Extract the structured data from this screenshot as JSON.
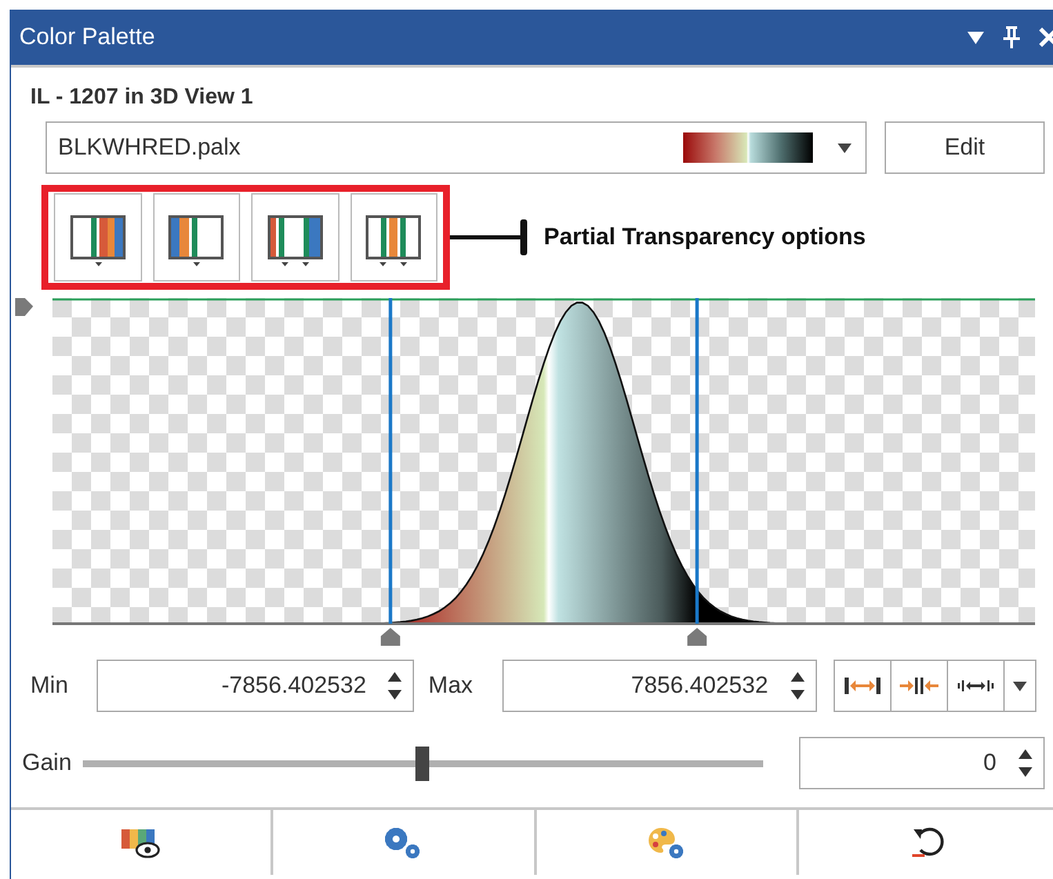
{
  "window": {
    "title": "Color Palette"
  },
  "title_buttons": [
    {
      "kind": "menu"
    },
    {
      "kind": "pin"
    },
    {
      "kind": "close"
    }
  ],
  "layer_label": "IL - 1207 in 3D View 1",
  "palette_dropdown": {
    "value": "BLKWHRED.palx"
  },
  "edit_button": "Edit",
  "transparency_buttons": [
    {
      "kind": "left"
    },
    {
      "kind": "right"
    },
    {
      "kind": "outer"
    },
    {
      "kind": "inner"
    }
  ],
  "annotation": "Partial Transparency options",
  "range_markers": [
    {
      "level": 0.344
    },
    {
      "level": 0.656
    }
  ],
  "min": {
    "label": "Min",
    "value": "-7856.402532"
  },
  "max": {
    "label": "Max",
    "value": "7856.402532"
  },
  "range_buttons": [
    {
      "kind": "expand"
    },
    {
      "kind": "contract"
    },
    {
      "kind": "fit"
    }
  ],
  "gain": {
    "label": "Gain",
    "level": 0.5,
    "value": "0"
  },
  "footer_buttons": [
    {
      "kind": "preview"
    },
    {
      "kind": "settings"
    },
    {
      "kind": "palette-settings"
    },
    {
      "kind": "reset"
    }
  ]
}
